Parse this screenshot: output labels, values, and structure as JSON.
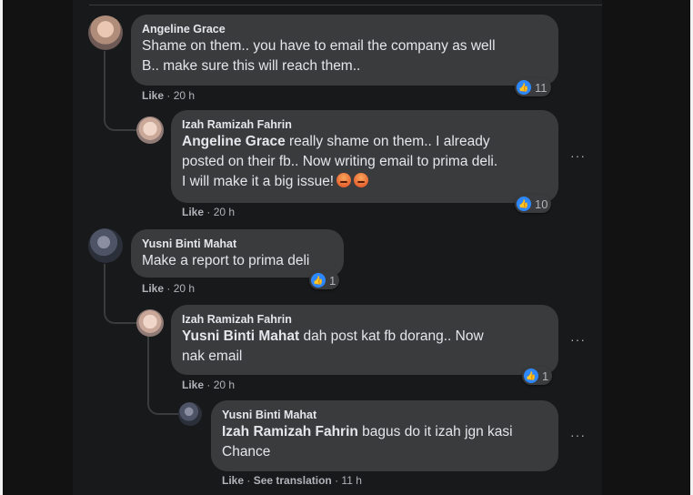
{
  "comments": [
    {
      "author": "Angeline Grace",
      "text": "Shame on them.. you have to email the company as well\nB.. make sure this will reach them..",
      "like": "Like",
      "time": "20 h",
      "reactions": "11"
    },
    {
      "author": "Izah Ramizah Fahrin",
      "mention": "Angeline Grace",
      "text": " really shame on them.. I already\nposted on their fb.. Now writing email to prima deli.\nI will make it a big issue!",
      "like": "Like",
      "time": "20 h",
      "reactions": "10"
    },
    {
      "author": "Yusni Binti Mahat",
      "text": "Make a report to prima deli",
      "like": "Like",
      "time": "20 h",
      "reactions": "1"
    },
    {
      "author": "Izah Ramizah Fahrin",
      "mention": "Yusni Binti Mahat",
      "text": " dah post kat fb dorang.. Now\nnak email",
      "like": "Like",
      "time": "20 h",
      "reactions": "1"
    },
    {
      "author": "Yusni Binti Mahat",
      "mention": "Izah Ramizah Fahrin",
      "text": " bagus do it izah jgn kasi\nChance",
      "like": "Like",
      "see_translation": "See translation",
      "time": "11 h"
    }
  ],
  "icons": {
    "more": "more-options-icon",
    "like_reaction": "thumbs-up-icon",
    "angry_emoji": "angry-face-icon"
  },
  "colors": {
    "like_blue": "#2d88ff",
    "bubble": "#3a3b3c",
    "background": "#18191a"
  },
  "separator": "·",
  "more_glyph": "···"
}
